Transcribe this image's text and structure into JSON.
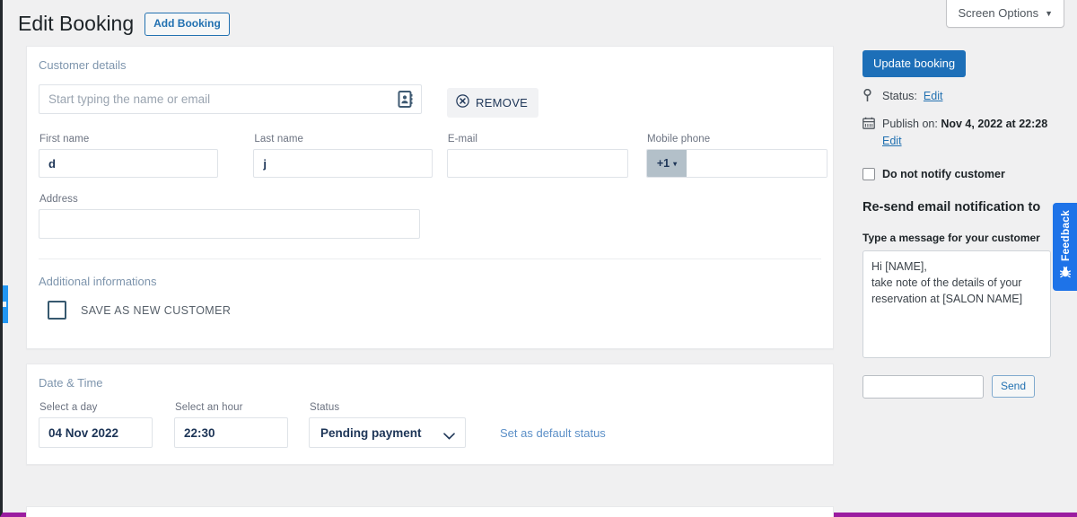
{
  "header": {
    "page_title": "Edit Booking",
    "add_booking_label": "Add Booking",
    "screen_options_label": "Screen Options",
    "screen_options_caret": "▼"
  },
  "customer_panel": {
    "title": "Customer details",
    "search_placeholder": "Start typing the name or email",
    "search_value": "",
    "search_icon": "address-book-icon",
    "remove_label": "REMOVE",
    "remove_icon": "circle-x-icon",
    "fields": {
      "first_name_label": "First name",
      "first_name_value": "d",
      "last_name_label": "Last name",
      "last_name_value": "j",
      "email_label": "E-mail",
      "email_value": "",
      "mobile_label": "Mobile phone",
      "mobile_country_code": "+1",
      "mobile_caret": "▾",
      "mobile_value": "",
      "address_label": "Address",
      "address_value": ""
    },
    "additional_title": "Additional informations",
    "save_new_customer_label": "SAVE AS NEW CUSTOMER",
    "save_new_customer_checked": false
  },
  "datetime_panel": {
    "title": "Date & Time",
    "day_label": "Select a day",
    "day_value": "04 Nov 2022",
    "hour_label": "Select an hour",
    "hour_value": "22:30",
    "status_label": "Status",
    "status_value": "Pending payment",
    "default_status_link": "Set as default status"
  },
  "sidebar": {
    "update_button": "Update booking",
    "status_icon": "pin-icon",
    "status_prefix": "Status:",
    "status_edit": "Edit",
    "publish_icon": "calendar-icon",
    "publish_prefix": "Publish on:",
    "publish_value": "Nov 4, 2022 at 22:28",
    "publish_edit": "Edit",
    "do_not_notify_label": "Do not notify customer",
    "do_not_notify_checked": false,
    "resend_title": "Re-send email notification to",
    "message_label": "Type a message for your customer",
    "message_value": "Hi [NAME],\ntake note of the details of your reservation at [SALON NAME]",
    "send_input_value": "",
    "send_button": "Send"
  },
  "feedback_tab": {
    "label": "Feedback",
    "icon": "bug-icon"
  },
  "colors": {
    "accent_blue": "#1d6fb8",
    "link_blue": "#2271b1",
    "panel_title": "#7e95ad",
    "feedback_blue": "#1e73e8",
    "bottom_border_purple": "#9b1ca0",
    "value_text": "#1d3557",
    "phone_prefix_bg": "#b3c0c9"
  }
}
